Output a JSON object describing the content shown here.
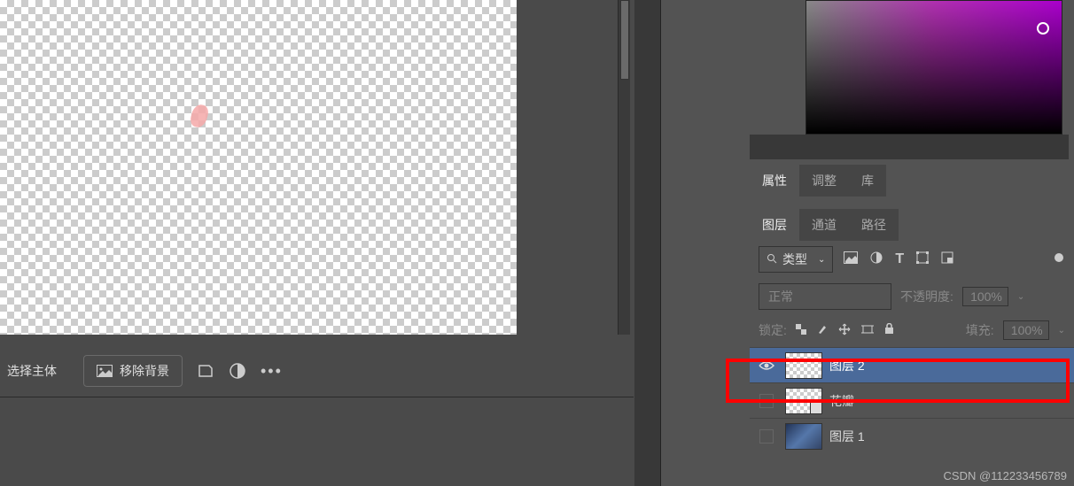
{
  "options_bar": {
    "select_subject": "选择主体",
    "remove_background": "移除背景"
  },
  "tabs1": {
    "properties": "属性",
    "adjustments": "调整",
    "libraries": "库"
  },
  "tabs2": {
    "layers": "图层",
    "channels": "通道",
    "paths": "路径"
  },
  "layer_panel": {
    "type_label": "类型",
    "blend_mode": "正常",
    "opacity_label": "不透明度:",
    "opacity_value": "100%",
    "lock_label": "锁定:",
    "fill_label": "填充:",
    "fill_value": "100%"
  },
  "layers": [
    {
      "name": "图层 2",
      "visible": true,
      "selected": true,
      "thumb": "checker"
    },
    {
      "name": "花瓣",
      "visible": false,
      "selected": false,
      "thumb": "checker",
      "smart": true
    },
    {
      "name": "图层 1",
      "visible": false,
      "selected": false,
      "thumb": "image"
    }
  ],
  "watermark": "CSDN @112233456789"
}
